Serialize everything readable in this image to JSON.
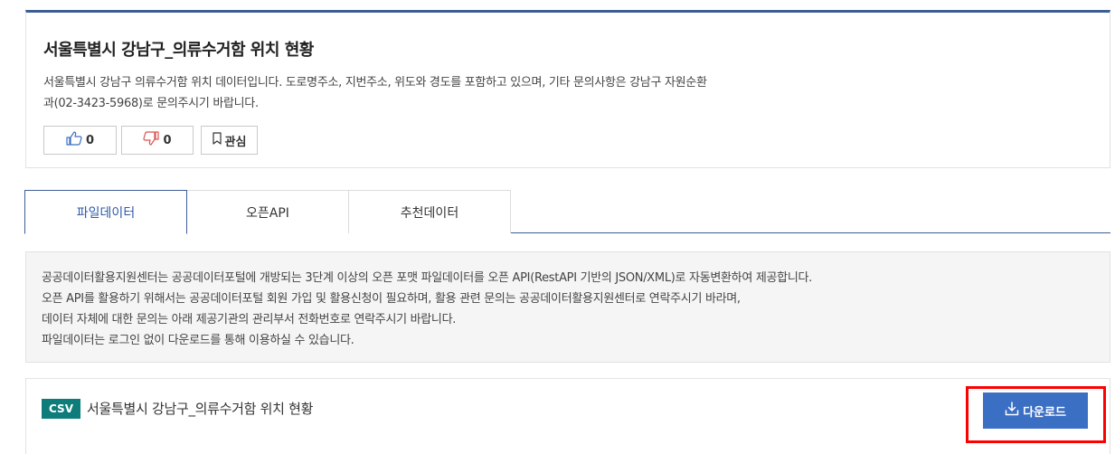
{
  "dataset": {
    "title": "서울특별시 강남구_의류수거함 위치 현황",
    "description_line1": "서울특별시 강남구 의류수거함 위치 데이터입니다. 도로명주소, 지번주소, 위도와 경도를 포함하고 있으며, 기타 문의사항은 강남구 자원순환",
    "description_line2": "과(02-3423-5968)로 문의주시기 바랍니다."
  },
  "actions": {
    "like_count": "0",
    "dislike_count": "0",
    "favorite_label": "관심"
  },
  "tabs": [
    {
      "label": "파일데이터",
      "active": true
    },
    {
      "label": "오픈API",
      "active": false
    },
    {
      "label": "추천데이터",
      "active": false
    }
  ],
  "notice": [
    "공공데이터활용지원센터는 공공데이터포털에 개방되는 3단계 이상의 오픈 포맷 파일데이터를 오픈 API(RestAPI 기반의 JSON/XML)로 자동변환하여 제공합니다.",
    "오픈 API를 활용하기 위해서는 공공데이터포털 회원 가입 및 활용신청이 필요하며, 활용 관련 문의는 공공데이터활용지원센터로 연락주시기 바라며,",
    "데이터 자체에 대한 문의는 아래 제공기관의 관리부서 전화번호로 연락주시기 바랍니다.",
    "파일데이터는 로그인 없이 다운로드를 통해 이용하실 수 있습니다."
  ],
  "file": {
    "format": "CSV",
    "name": "서울특별시 강남구_의류수거함 위치 현황",
    "download_label": "다운로드"
  },
  "colors": {
    "accent": "#3d5d94",
    "download_button": "#3b6fc4",
    "csv_badge": "#0f7c7c",
    "highlight": "#ff0000"
  }
}
